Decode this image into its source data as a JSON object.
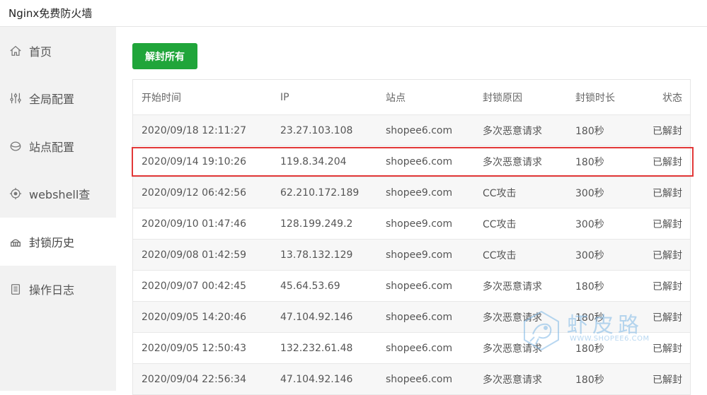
{
  "app": {
    "title": "Nginx免费防火墙"
  },
  "sidebar": {
    "items": [
      {
        "label": "首页",
        "icon": "home-icon",
        "active": false
      },
      {
        "label": "全局配置",
        "icon": "sliders-icon",
        "active": false
      },
      {
        "label": "站点配置",
        "icon": "globe-icon",
        "active": false
      },
      {
        "label": "webshell查",
        "icon": "target-icon",
        "active": false
      },
      {
        "label": "封锁历史",
        "icon": "lock-history-icon",
        "active": true
      },
      {
        "label": "操作日志",
        "icon": "clipboard-icon",
        "active": false
      }
    ]
  },
  "toolbar": {
    "unblock_all_label": "解封所有"
  },
  "table": {
    "columns": [
      "开始时间",
      "IP",
      "站点",
      "封锁原因",
      "封锁时长",
      "状态"
    ],
    "rows": [
      {
        "time": "2020/09/18 12:11:27",
        "ip": "23.27.103.108",
        "site": "shopee6.com",
        "reason": "多次恶意请求",
        "duration": "180秒",
        "status": "已解封"
      },
      {
        "time": "2020/09/14 19:10:26",
        "ip": "119.8.34.204",
        "site": "shopee6.com",
        "reason": "多次恶意请求",
        "duration": "180秒",
        "status": "已解封"
      },
      {
        "time": "2020/09/12 06:42:56",
        "ip": "62.210.172.189",
        "site": "shopee9.com",
        "reason": "CC攻击",
        "duration": "300秒",
        "status": "已解封"
      },
      {
        "time": "2020/09/10 01:47:46",
        "ip": "128.199.249.2",
        "site": "shopee9.com",
        "reason": "CC攻击",
        "duration": "300秒",
        "status": "已解封"
      },
      {
        "time": "2020/09/08 01:42:59",
        "ip": "13.78.132.129",
        "site": "shopee9.com",
        "reason": "CC攻击",
        "duration": "300秒",
        "status": "已解封"
      },
      {
        "time": "2020/09/07 00:42:45",
        "ip": "45.64.53.69",
        "site": "shopee6.com",
        "reason": "多次恶意请求",
        "duration": "180秒",
        "status": "已解封"
      },
      {
        "time": "2020/09/05 14:20:46",
        "ip": "47.104.92.146",
        "site": "shopee6.com",
        "reason": "多次恶意请求",
        "duration": "180秒",
        "status": "已解封"
      },
      {
        "time": "2020/09/05 12:50:43",
        "ip": "132.232.61.48",
        "site": "shopee6.com",
        "reason": "多次恶意请求",
        "duration": "180秒",
        "status": "已解封"
      },
      {
        "time": "2020/09/04 22:56:34",
        "ip": "47.104.92.146",
        "site": "shopee6.com",
        "reason": "多次恶意请求",
        "duration": "180秒",
        "status": "已解封"
      }
    ]
  },
  "watermark": {
    "name": "虾皮路",
    "url": "WWW.SHOPEE6.COM"
  },
  "colors": {
    "accent": "#20a53a",
    "highlight": "#e23838",
    "sidebar_bg": "#f2f2f2",
    "watermark": "#7fb8e6"
  }
}
